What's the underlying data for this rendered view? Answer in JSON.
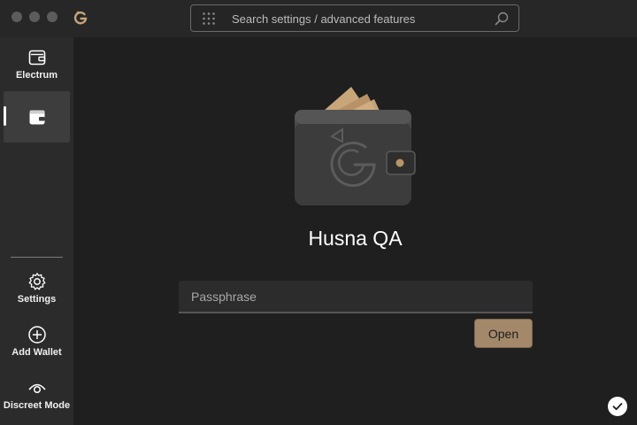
{
  "titlebar": {
    "search_placeholder": "Search settings / advanced features",
    "icons": [
      "close-dot",
      "minimize-dot",
      "maximize-dot",
      "app-logo-icon",
      "grid-icon",
      "search-icon"
    ]
  },
  "sidebar": {
    "items": [
      {
        "label": "Electrum",
        "icon": "wallet-icon"
      },
      {
        "label": "",
        "icon": "wallet-filled-icon",
        "selected": true
      },
      {
        "label": "Settings",
        "icon": "gear-icon"
      },
      {
        "label": "Add Wallet",
        "icon": "plus-circle-icon"
      },
      {
        "label": "Discreet Mode",
        "icon": "eye-icon"
      }
    ]
  },
  "main": {
    "wallet_name": "Husna QA",
    "passphrase_placeholder": "Passphrase",
    "passphrase_value": "",
    "open_label": "Open"
  },
  "status": {
    "icon": "checkmark-icon"
  },
  "colors": {
    "accent": "#a3896a",
    "background": "#1f1f1f",
    "sidebar": "#2b2b2b",
    "titlebar": "#272727"
  }
}
